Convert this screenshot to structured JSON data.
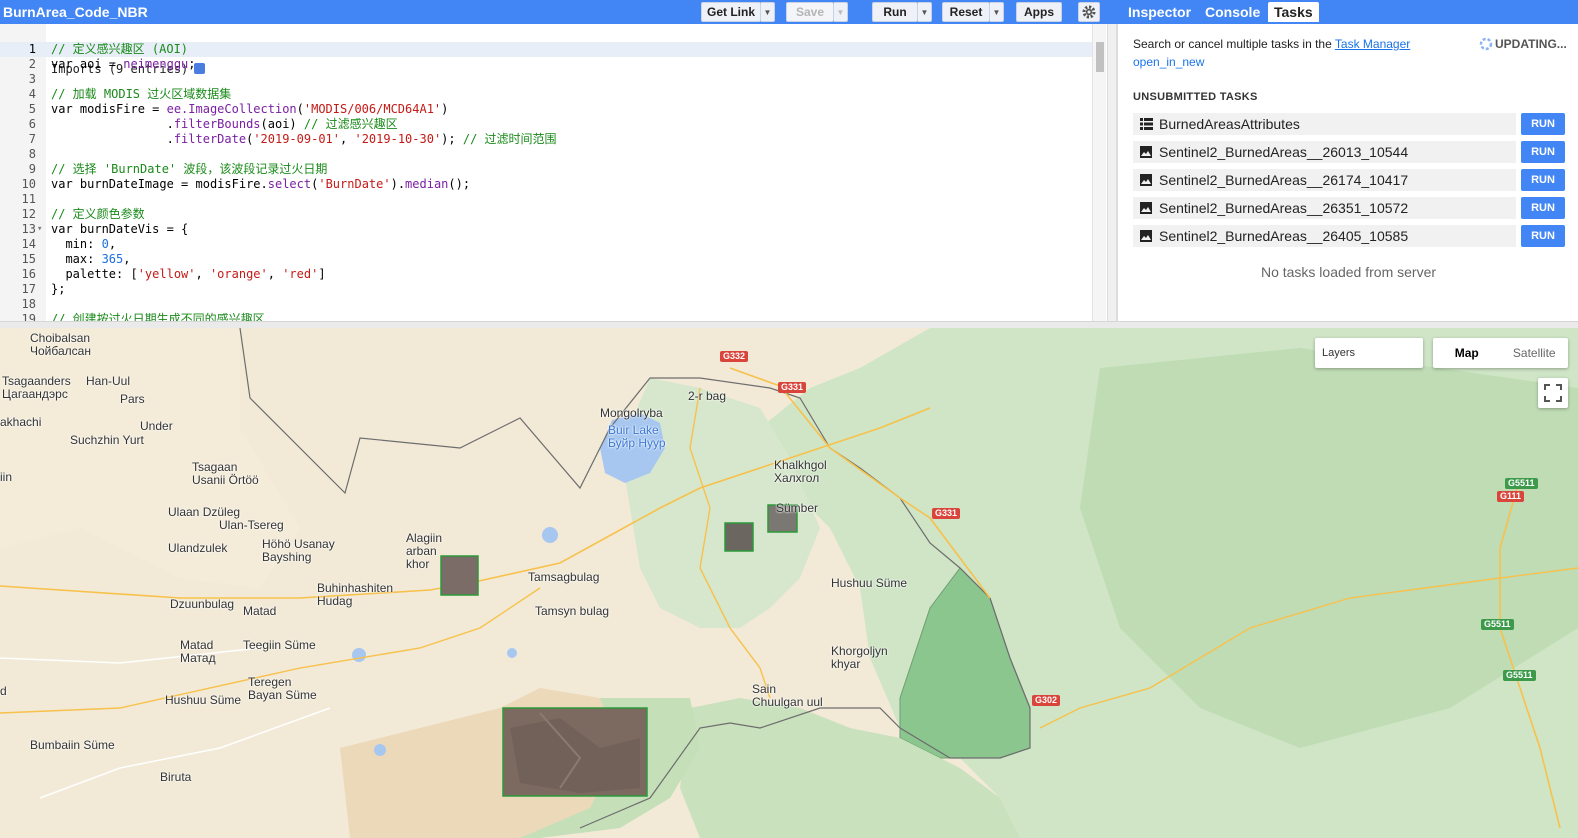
{
  "toolbar": {
    "title": "BurnArea_Code_NBR",
    "get_link": "Get Link",
    "save": "Save",
    "run": "Run",
    "reset": "Reset",
    "apps": "Apps"
  },
  "tabs": [
    "Inspector",
    "Console",
    "Tasks"
  ],
  "tasks": {
    "manager_prefix": "Search or cancel multiple tasks in the ",
    "manager_link": "Task Manager",
    "open_new": "open_in_new",
    "updating": "UPDATING...",
    "section": "UNSUBMITTED TASKS",
    "run_label": "RUN",
    "items": [
      {
        "name": "BurnedAreasAttributes",
        "icon": "table-icon"
      },
      {
        "name": "Sentinel2_BurnedAreas__26013_10544",
        "icon": "image-icon"
      },
      {
        "name": "Sentinel2_BurnedAreas__26174_10417",
        "icon": "image-icon"
      },
      {
        "name": "Sentinel2_BurnedAreas__26351_10572",
        "icon": "image-icon"
      },
      {
        "name": "Sentinel2_BurnedAreas__26405_10585",
        "icon": "image-icon"
      }
    ],
    "empty": "No tasks loaded from server"
  },
  "editor": {
    "imports": "Imports (9 entries)",
    "lines": [
      {
        "n": "1",
        "html": "<span class='c-com'>// 定义感兴趣区 (AOI)</span>"
      },
      {
        "n": "2",
        "html": "var aoi = <span class='c-fn'>neimenggu</span>;"
      },
      {
        "n": "3",
        "html": ""
      },
      {
        "n": "4",
        "html": "<span class='c-com'>// 加载 MODIS 过火区域数据集</span>"
      },
      {
        "n": "5",
        "html": "var modisFire = <span class='c-fn'>ee.ImageCollection</span>(<span class='c-str'>'MODIS/006/MCD64A1'</span>)"
      },
      {
        "n": "6",
        "html": "                .<span class='c-fn'>filterBounds</span>(aoi) <span class='c-com'>// 过滤感兴趣区</span>"
      },
      {
        "n": "7",
        "html": "                .<span class='c-fn'>filterDate</span>(<span class='c-str'>'2019-09-01'</span>, <span class='c-str'>'2019-10-30'</span>); <span class='c-com'>// 过滤时间范围</span>"
      },
      {
        "n": "8",
        "html": ""
      },
      {
        "n": "9",
        "html": "<span class='c-com'>// 选择 'BurnDate' 波段，该波段记录过火日期</span>"
      },
      {
        "n": "10",
        "html": "var burnDateImage = modisFire.<span class='c-fn'>select</span>(<span class='c-str'>'BurnDate'</span>).<span class='c-fn'>median</span>();"
      },
      {
        "n": "11",
        "html": ""
      },
      {
        "n": "12",
        "html": "<span class='c-com'>// 定义颜色参数</span>"
      },
      {
        "n": "13",
        "html": "var burnDateVis = {"
      },
      {
        "n": "14",
        "html": "  min: <span class='c-num'>0</span>,"
      },
      {
        "n": "15",
        "html": "  max: <span class='c-num'>365</span>,"
      },
      {
        "n": "16",
        "html": "  palette: [<span class='c-str'>'yellow'</span>, <span class='c-str'>'orange'</span>, <span class='c-str'>'red'</span>]"
      },
      {
        "n": "17",
        "html": "};"
      },
      {
        "n": "18",
        "html": ""
      },
      {
        "n": "19",
        "html": "<span class='c-com'>// 创建按过火日期生成不同的感兴趣区</span>"
      }
    ]
  },
  "map": {
    "layers": "Layers",
    "map_btn": "Map",
    "satellite_btn": "Satellite",
    "labels": [
      {
        "t": "Choibalsan\nЧойбалсан"
      },
      {
        "t": "Tsagaanders\nЦагаандэрс"
      },
      {
        "t": "Han-Uul"
      },
      {
        "t": "Pars"
      },
      {
        "t": "akhachi"
      },
      {
        "t": "Under"
      },
      {
        "t": "Suchzhin Yurt"
      },
      {
        "t": "Tsagaan\nUsanii Örtöö"
      },
      {
        "t": "Ulaan Dzüleg"
      },
      {
        "t": "Ulan-Tsereg"
      },
      {
        "t": "Höhö Usanay\nBayshing"
      },
      {
        "t": "Ulandzulek"
      },
      {
        "t": "Alagiin\narban\nkhor"
      },
      {
        "t": "Buhinhashiten\nHudag"
      },
      {
        "t": "Dzuunbulag"
      },
      {
        "t": "Matad"
      },
      {
        "t": "Matad\nМатад"
      },
      {
        "t": "Teegiin Süme"
      },
      {
        "t": "Teregen\nBayan Süme"
      },
      {
        "t": "Hushuu Süme"
      },
      {
        "t": "Bumbaiin Süme"
      },
      {
        "t": "Biruta"
      },
      {
        "t": "Tamsagbulag"
      },
      {
        "t": "Tamsyn bulag"
      },
      {
        "t": "Mongolryba"
      },
      {
        "t": "Buir Lake\nБуйр Нуур"
      },
      {
        "t": "2-r bag"
      },
      {
        "t": "Khalkhgol\nХалхгол"
      },
      {
        "t": "Sümber"
      },
      {
        "t": "Hushuu Süme"
      },
      {
        "t": "Khorgoljyn\nkhyar"
      },
      {
        "t": "Sain\nChuulgan uul"
      },
      {
        "t": "iin"
      },
      {
        "t": "d"
      }
    ],
    "shields": [
      {
        "t": "G332"
      },
      {
        "t": "G331"
      },
      {
        "t": "G331"
      },
      {
        "t": "G302"
      },
      {
        "t": "G5511"
      },
      {
        "t": "G111"
      },
      {
        "t": "G5511"
      },
      {
        "t": "G5511"
      }
    ]
  },
  "colors": {
    "accent": "#4285f4",
    "run_button": "#4285f4"
  }
}
